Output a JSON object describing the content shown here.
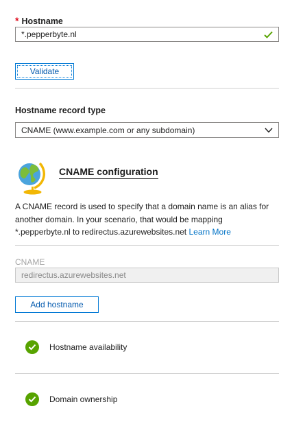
{
  "hostname": {
    "required_marker": "*",
    "label": "Hostname",
    "value": "*.pepperbyte.nl",
    "valid_icon": "checkmark-icon"
  },
  "validate_label": "Validate",
  "record_type": {
    "label": "Hostname record type",
    "selected": "CNAME (www.example.com or any subdomain)",
    "chevron_icon": "chevron-down-icon"
  },
  "cname_config": {
    "icon": "globe-icon",
    "title": "CNAME configuration",
    "description": "A CNAME record is used to specify that a domain name is an alias for another domain. In your scenario, that would be mapping *.pepperbyte.nl to redirectus.azurewebsites.net",
    "learn_more": "Learn More"
  },
  "cname_field": {
    "label": "CNAME",
    "value": "redirectus.azurewebsites.net"
  },
  "add_hostname_label": "Add hostname",
  "checks": [
    {
      "label": "Hostname availability",
      "icon": "check-circle-icon",
      "status": "success"
    },
    {
      "label": "Domain ownership",
      "icon": "check-circle-icon",
      "status": "success"
    }
  ],
  "colors": {
    "accent": "#0078d4",
    "success": "#57a300",
    "required": "#e00b1c"
  }
}
